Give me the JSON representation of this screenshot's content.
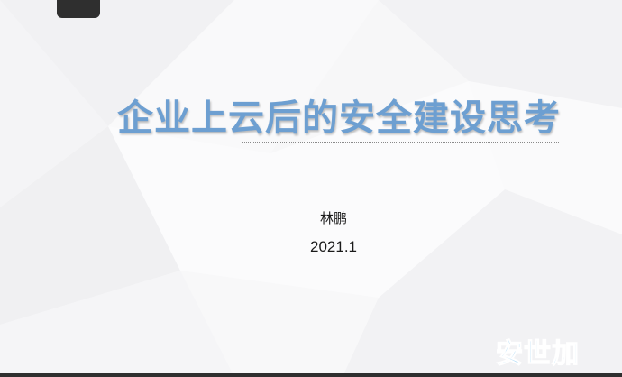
{
  "slide": {
    "title": "企业上云后的安全建设思考",
    "author": "林鹏",
    "date": "2021.1",
    "watermark": "安世加"
  },
  "colors": {
    "title": "#6d9fd1",
    "watermark": "#3fa6e8",
    "background": "#f7f7f8",
    "dark_accent": "#2f2f2f"
  }
}
